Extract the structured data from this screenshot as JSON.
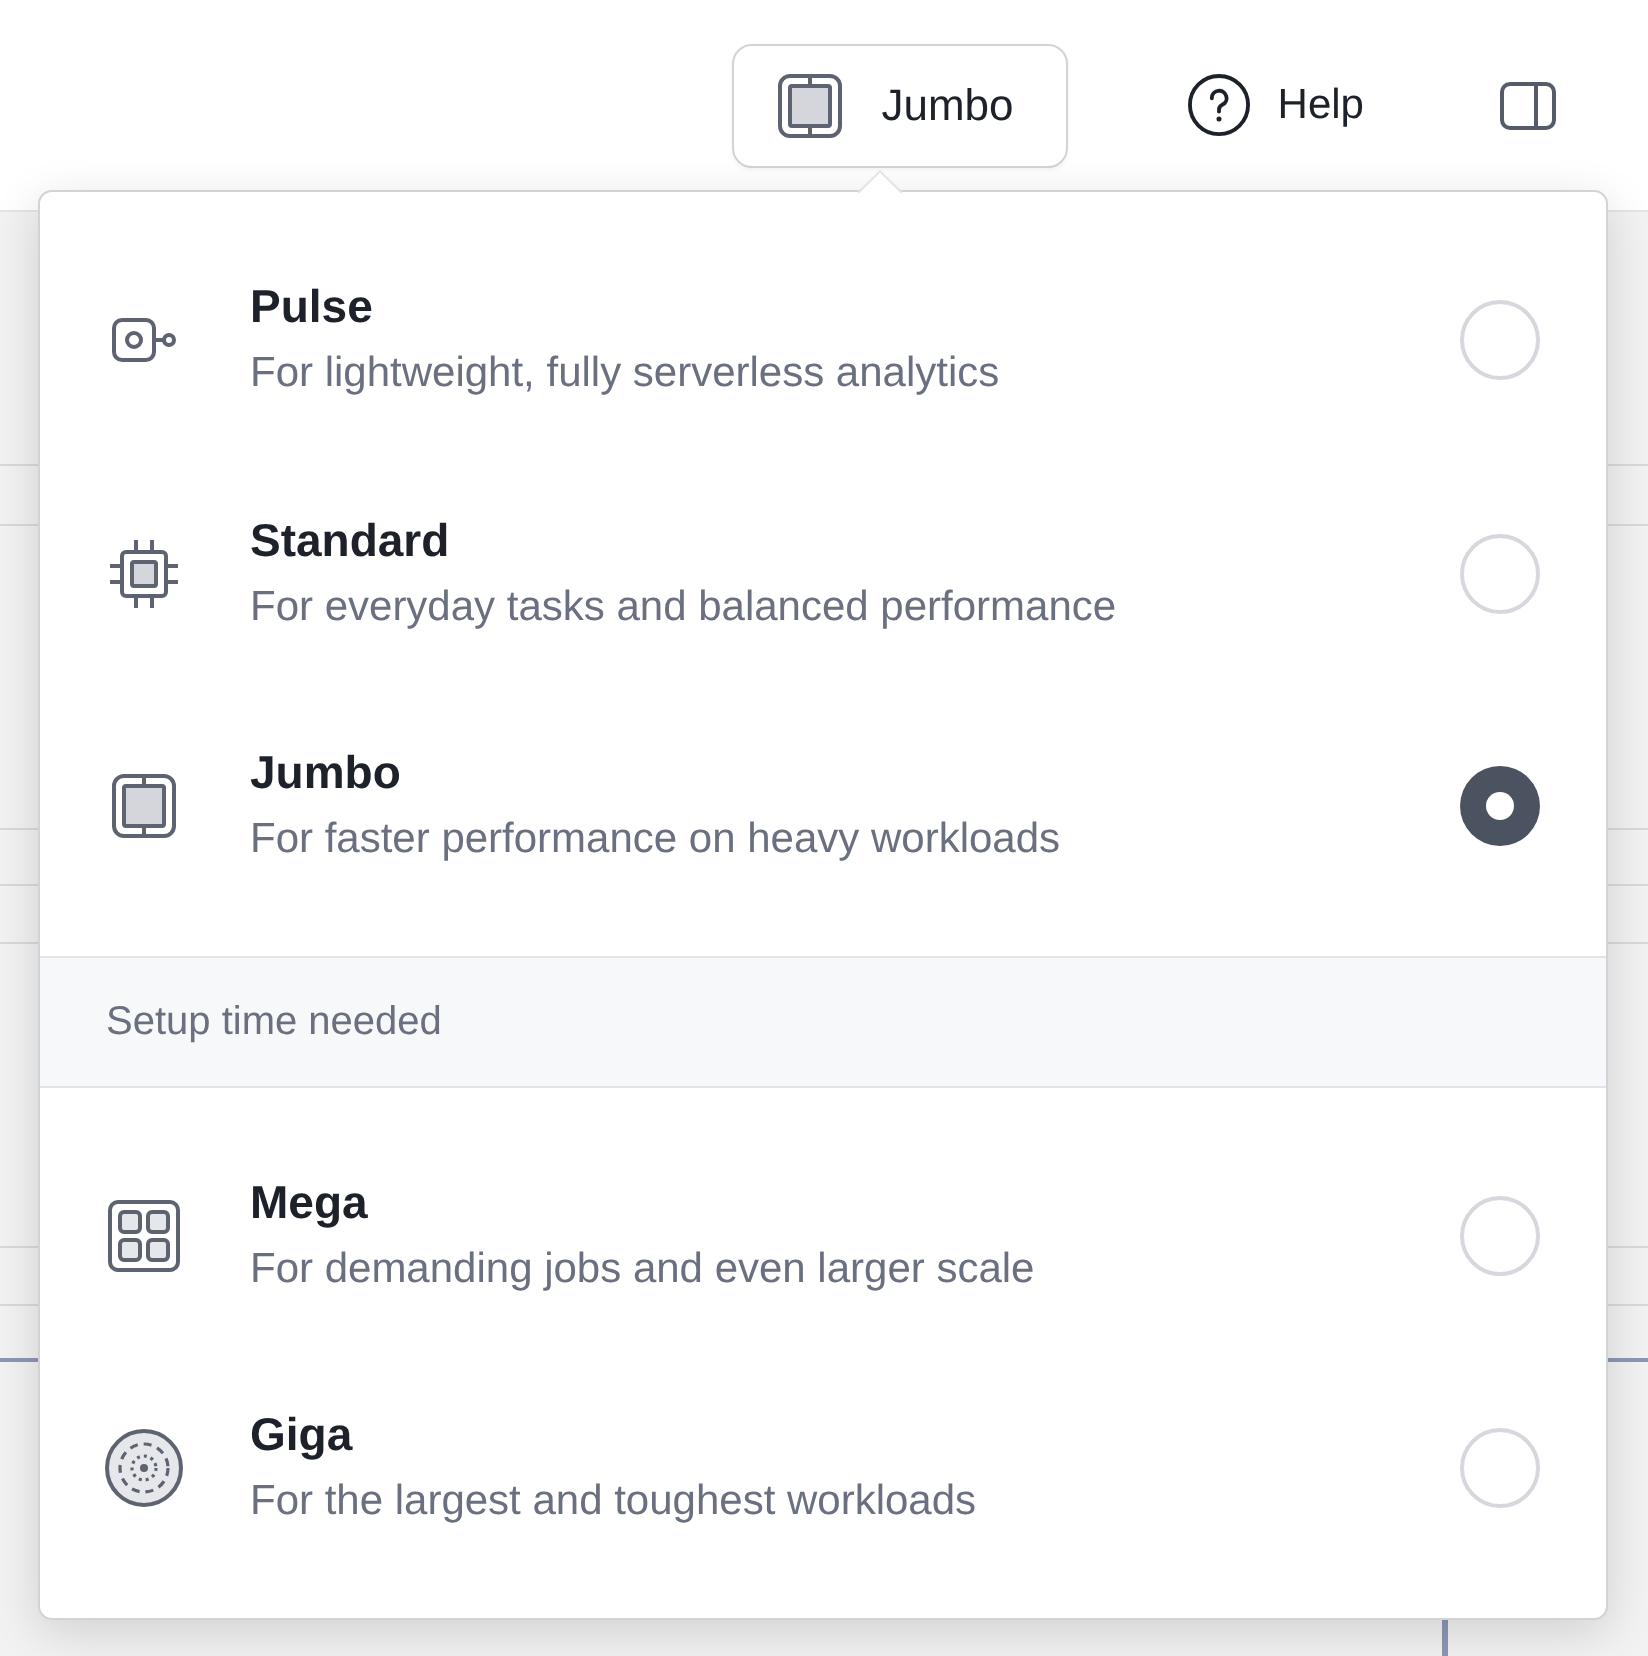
{
  "top_bar": {
    "plan_button": {
      "label": "Jumbo"
    },
    "help_button": {
      "label": "Help"
    }
  },
  "plan_menu": {
    "sections": [
      {
        "items": [
          {
            "kind": "pulse",
            "name": "Pulse",
            "description": "For lightweight, fully serverless analytics",
            "selected": false
          },
          {
            "kind": "standard",
            "name": "Standard",
            "description": "For everyday tasks and balanced performance",
            "selected": false
          },
          {
            "kind": "jumbo",
            "name": "Jumbo",
            "description": "For faster performance on heavy workloads",
            "selected": true
          }
        ]
      },
      {
        "header": "Setup time needed",
        "items": [
          {
            "kind": "mega",
            "name": "Mega",
            "description": "For demanding jobs and even larger scale",
            "selected": false
          },
          {
            "kind": "giga",
            "name": "Giga",
            "description": "For the largest and toughest workloads",
            "selected": false
          }
        ]
      }
    ]
  }
}
